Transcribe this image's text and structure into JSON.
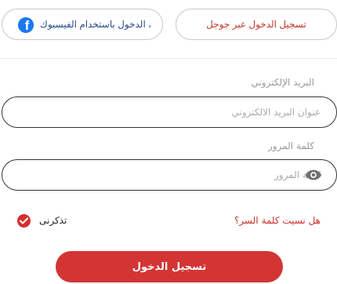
{
  "social": {
    "google_label": "تسجيل الدخول عبر جوجل",
    "facebook_label": "، الدخول باستخدام الفيسبوك"
  },
  "email": {
    "label": "البريد الإلكتروني",
    "placeholder": "عنوان البريد الالكتروني",
    "value": ""
  },
  "password": {
    "label": "كلمة المرور",
    "placeholder": "كلمة المرور",
    "value": ""
  },
  "remember_me": {
    "label": "تذكرنى",
    "checked": true
  },
  "forgot_password_label": "هل نسيت كلمة السر؟",
  "submit_label": "تسجيل الدخول",
  "colors": {
    "accent": "#d33535",
    "link": "#c9302c",
    "facebook_blue": "#1877f2",
    "facebook_text": "#2b4b8b"
  },
  "icons": {
    "facebook": "facebook-icon",
    "password_toggle": "eye-icon",
    "remember_check": "check-icon"
  }
}
